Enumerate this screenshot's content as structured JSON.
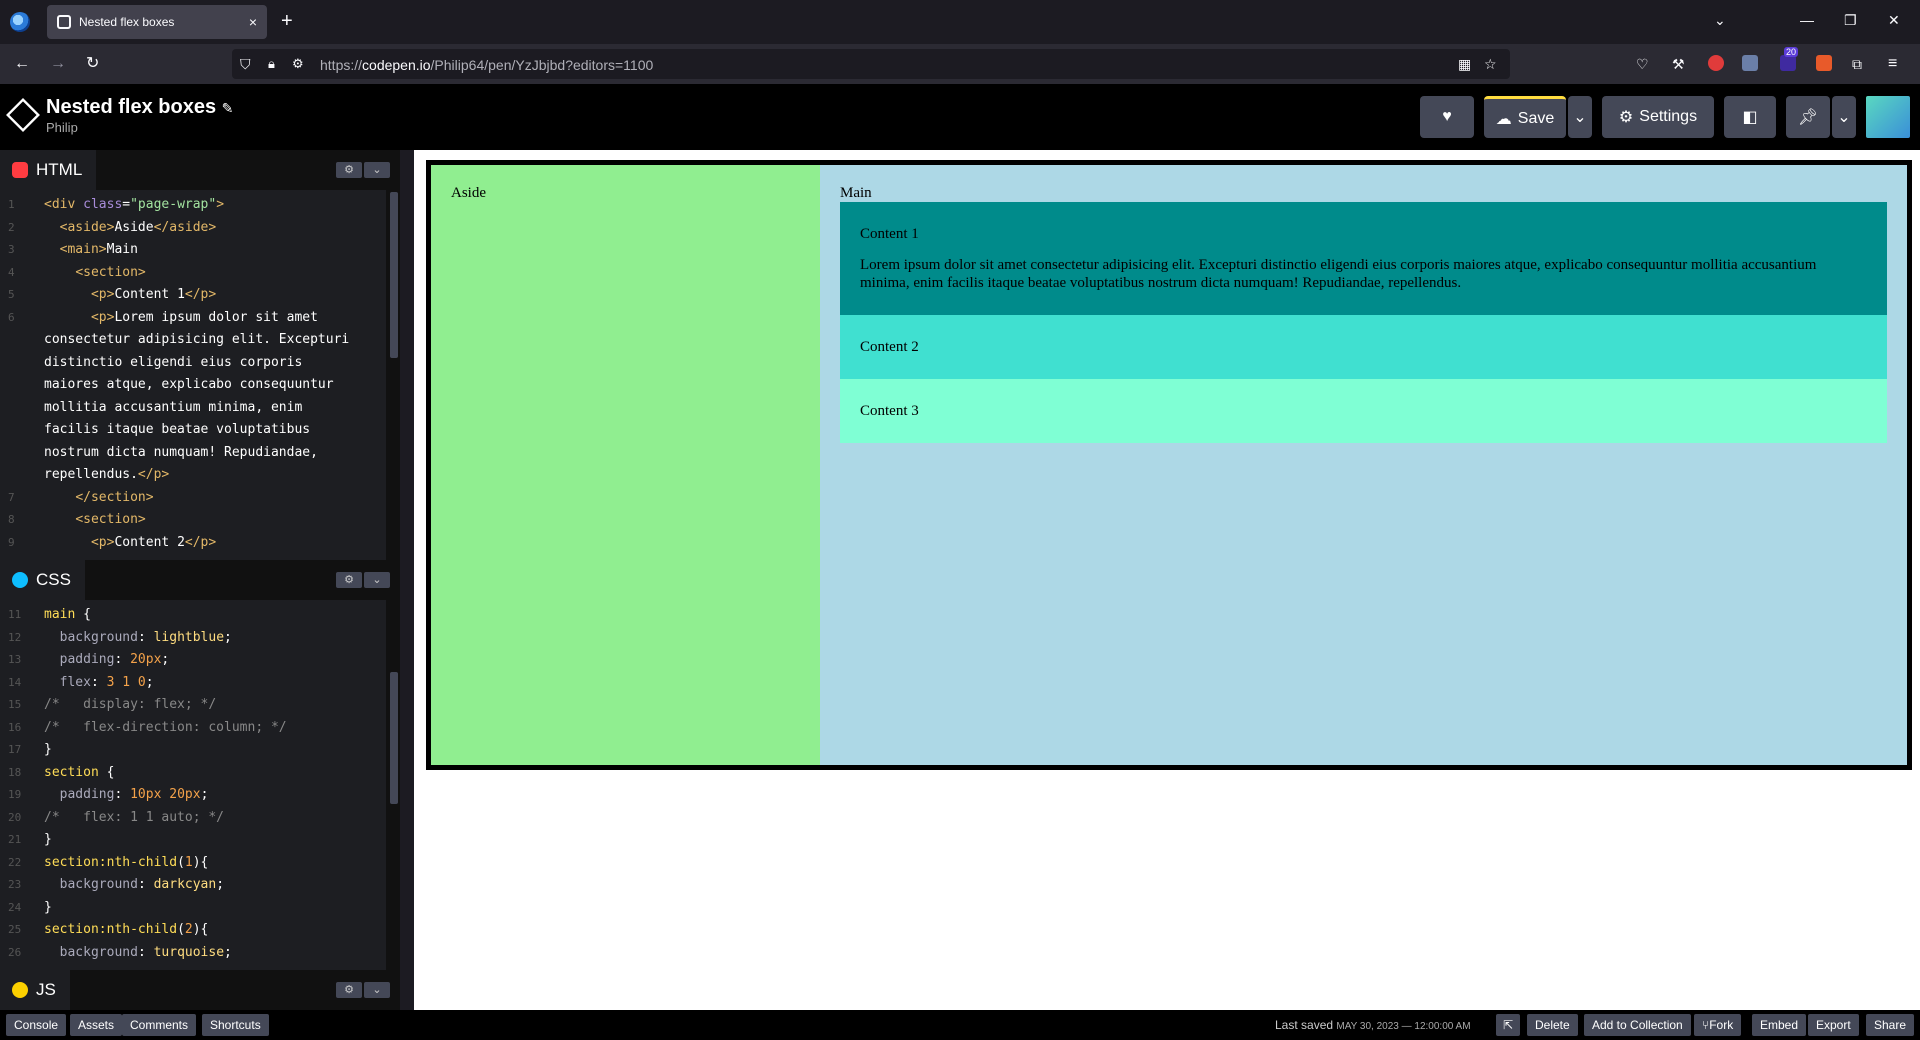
{
  "browser": {
    "tab_title": "Nested flex boxes",
    "tab_close": "×",
    "new_tab": "+",
    "url_prefix": "https://",
    "url_domain": "codepen.io",
    "url_path": "/Philip64/pen/YzJbjbd?editors=1100",
    "extension_badge": "20"
  },
  "header": {
    "title": "Nested flex boxes",
    "edit_glyph": "✎",
    "user": "Philip",
    "save_label": "Save",
    "settings_label": "Settings"
  },
  "editors": {
    "html": {
      "label": "HTML",
      "lines": [
        {
          "n": "1",
          "html": "<span class='tag'>&lt;div</span> <span class='attr'>class</span>=<span class='str'>\"page-wrap\"</span><span class='tag'>&gt;</span>"
        },
        {
          "n": "2",
          "html": "  <span class='tag'>&lt;aside&gt;</span>Aside<span class='tag'>&lt;/aside&gt;</span>"
        },
        {
          "n": "3",
          "html": "  <span class='tag'>&lt;main&gt;</span>Main"
        },
        {
          "n": "4",
          "html": "    <span class='tag'>&lt;section&gt;</span>"
        },
        {
          "n": "5",
          "html": "      <span class='tag'>&lt;p&gt;</span>Content 1<span class='tag'>&lt;/p&gt;</span>"
        },
        {
          "n": "6",
          "html": "      <span class='tag'>&lt;p&gt;</span>Lorem ipsum dolor sit amet"
        },
        {
          "n": "",
          "html": "consectetur adipisicing elit. Excepturi"
        },
        {
          "n": "",
          "html": "distinctio eligendi eius corporis"
        },
        {
          "n": "",
          "html": "maiores atque, explicabo consequuntur"
        },
        {
          "n": "",
          "html": "mollitia accusantium minima, enim"
        },
        {
          "n": "",
          "html": "facilis itaque beatae voluptatibus"
        },
        {
          "n": "",
          "html": "nostrum dicta numquam! Repudiandae,"
        },
        {
          "n": "",
          "html": "repellendus.<span class='tag'>&lt;/p&gt;</span>"
        },
        {
          "n": "7",
          "html": "    <span class='tag'>&lt;/section&gt;</span>"
        },
        {
          "n": "8",
          "html": "    <span class='tag'>&lt;section&gt;</span>"
        },
        {
          "n": "9",
          "html": "      <span class='tag'>&lt;p&gt;</span>Content 2<span class='tag'>&lt;/p&gt;</span>"
        }
      ]
    },
    "css": {
      "label": "CSS",
      "lines": [
        {
          "n": "11",
          "html": "<span class='sel'>main</span> {"
        },
        {
          "n": "12",
          "html": "  <span class='prop'>background</span>: <span class='val'>lightblue</span>;"
        },
        {
          "n": "13",
          "html": "  <span class='prop'>padding</span>: <span class='num'>20px</span>;"
        },
        {
          "n": "14",
          "html": "  <span class='prop'>flex</span>: <span class='num'>3 1 0</span>;"
        },
        {
          "n": "15",
          "html": "<span class='cmt'>/*   display: flex; */</span>"
        },
        {
          "n": "16",
          "html": "<span class='cmt'>/*   flex-direction: column; */</span>"
        },
        {
          "n": "17",
          "html": "}"
        },
        {
          "n": "18",
          "html": "<span class='sel'>section</span> {"
        },
        {
          "n": "19",
          "html": "  <span class='prop'>padding</span>: <span class='num'>10px 20px</span>;"
        },
        {
          "n": "20",
          "html": "<span class='cmt'>/*   flex: 1 1 auto; */</span>"
        },
        {
          "n": "21",
          "html": "}"
        },
        {
          "n": "22",
          "html": "<span class='sel'>section:nth-child</span>(<span class='num'>1</span>){"
        },
        {
          "n": "23",
          "html": "  <span class='prop'>background</span>: <span class='val'>darkcyan</span>;"
        },
        {
          "n": "24",
          "html": "}"
        },
        {
          "n": "25",
          "html": "<span class='sel'>section:nth-child</span>(<span class='num'>2</span>){"
        },
        {
          "n": "26",
          "html": "  <span class='prop'>background</span>: <span class='val'>turquoise</span>;"
        }
      ]
    },
    "js": {
      "label": "JS"
    }
  },
  "preview": {
    "aside": "Aside",
    "main": "Main",
    "content1": "Content 1",
    "lorem": "Lorem ipsum dolor sit amet consectetur adipisicing elit. Excepturi distinctio eligendi eius corporis maiores atque, explicabo consequuntur mollitia accusantium minima, enim facilis itaque beatae voluptatibus nostrum dicta numquam! Repudiandae, repellendus.",
    "content2": "Content 2",
    "content3": "Content 3"
  },
  "bottom": {
    "console": "Console",
    "assets": "Assets",
    "comments": "Comments",
    "shortcuts": "Shortcuts",
    "last_saved_label": "Last saved",
    "last_saved_value": "MAY 30, 2023 — 12:00:00 AM",
    "delete": "Delete",
    "add_to_collection": "Add to Collection",
    "fork": "Fork",
    "embed": "Embed",
    "export": "Export",
    "share": "Share"
  },
  "colors": {
    "aside_bg": "#90ee90",
    "main_bg": "#add8e6",
    "section1_bg": "#008b8b",
    "section2_bg": "#40e0d0",
    "section3_bg": "#7fffd4"
  }
}
